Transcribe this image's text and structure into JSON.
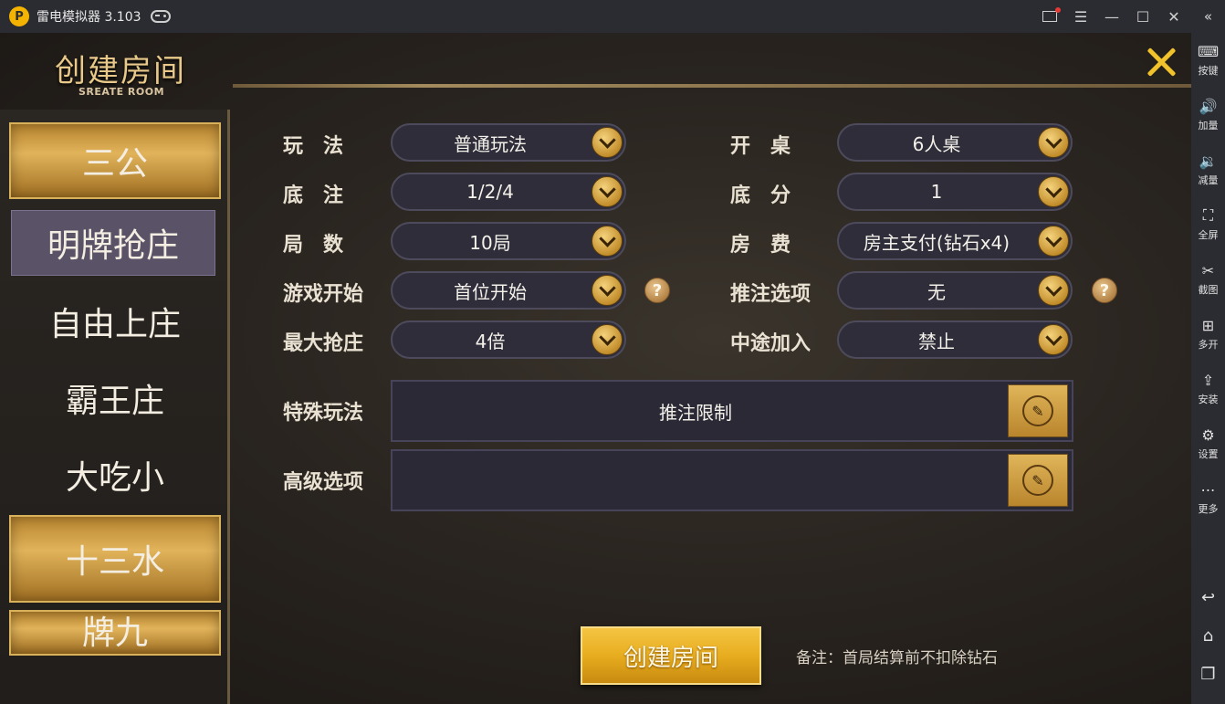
{
  "emulator": {
    "title": "雷电模拟器 3.103",
    "logo_icon": "leidian-logo-icon",
    "sidebar": [
      {
        "label": "按键",
        "icon": "keyboard-icon"
      },
      {
        "label": "加量",
        "icon": "volume-up-icon"
      },
      {
        "label": "减量",
        "icon": "volume-down-icon"
      },
      {
        "label": "全屏",
        "icon": "fullscreen-icon"
      },
      {
        "label": "截图",
        "icon": "scissors-icon"
      },
      {
        "label": "多开",
        "icon": "multi-instance-icon"
      },
      {
        "label": "安装",
        "icon": "apk-install-icon"
      },
      {
        "label": "设置",
        "icon": "gear-icon"
      },
      {
        "label": "更多",
        "icon": "more-icon"
      }
    ]
  },
  "header": {
    "title_cn": "创建房间",
    "title_en": "SREATE ROOM"
  },
  "categories": [
    {
      "label": "三公",
      "style": "gold"
    },
    {
      "label": "明牌抢庄",
      "style": "active"
    },
    {
      "label": "自由上庄",
      "style": "plain"
    },
    {
      "label": "霸王庄",
      "style": "plain"
    },
    {
      "label": "大吃小",
      "style": "plain"
    },
    {
      "label": "十三水",
      "style": "gold"
    },
    {
      "label": "牌九",
      "style": "gold"
    }
  ],
  "form": {
    "play_mode": {
      "label": "玩　法",
      "value": "普通玩法"
    },
    "table_size": {
      "label": "开　桌",
      "value": "6人桌"
    },
    "base_bet": {
      "label": "底　注",
      "value": "1/2/4"
    },
    "base_score": {
      "label": "底　分",
      "value": "1"
    },
    "rounds": {
      "label": "局　数",
      "value": "10局"
    },
    "room_fee": {
      "label": "房　费",
      "value": "房主支付(钻石x4)"
    },
    "game_start": {
      "label": "游戏开始",
      "value": "首位开始"
    },
    "push_bet": {
      "label": "推注选项",
      "value": "无"
    },
    "max_grab": {
      "label": "最大抢庄",
      "value": "4倍"
    },
    "join_midway": {
      "label": "中途加入",
      "value": "禁止"
    },
    "special": {
      "label": "特殊玩法",
      "value": "推注限制"
    },
    "advanced": {
      "label": "高级选项",
      "value": ""
    }
  },
  "create_button": "创建房间",
  "note": "备注：首局结算前不扣除钻石"
}
